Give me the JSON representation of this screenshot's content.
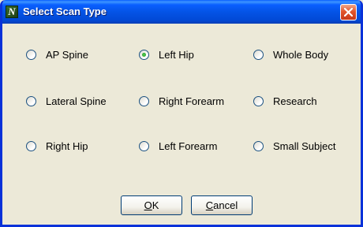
{
  "window": {
    "title": "Select Scan Type",
    "app_icon_letter": "N"
  },
  "scan_types": [
    {
      "label": "AP Spine",
      "checked": false
    },
    {
      "label": "Left Hip",
      "checked": true
    },
    {
      "label": "Whole Body",
      "checked": false
    },
    {
      "label": "Lateral Spine",
      "checked": false
    },
    {
      "label": "Right Forearm",
      "checked": false
    },
    {
      "label": "Research",
      "checked": false
    },
    {
      "label": "Right Hip",
      "checked": false
    },
    {
      "label": "Left Forearm",
      "checked": false
    },
    {
      "label": "Small Subject",
      "checked": false
    }
  ],
  "buttons": {
    "ok": {
      "mnemonic": "O",
      "rest": "K"
    },
    "cancel": {
      "mnemonic": "C",
      "rest": "ancel"
    }
  },
  "colors": {
    "titlebar": "#0454e6",
    "dialog_bg": "#ece9d8",
    "radio_selected": "#21a121",
    "close_button": "#e2552a"
  }
}
